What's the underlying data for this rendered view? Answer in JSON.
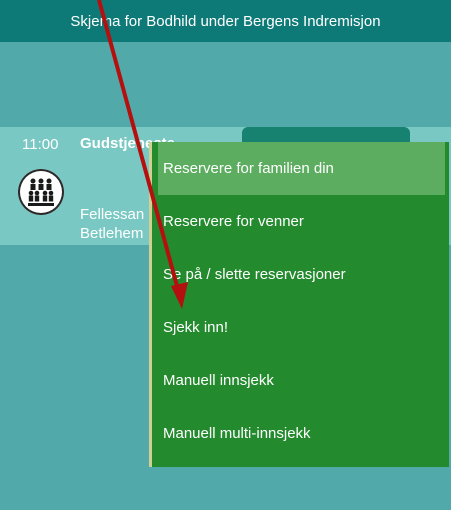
{
  "header": {
    "title": "Skjema for Bodhild under Bergens Indremisjon"
  },
  "event": {
    "time": "11:00",
    "title": "Gudstjeneste",
    "description_line1": "Fellessan",
    "description_line2": "Betlehem"
  },
  "menu": {
    "items": [
      {
        "label": "Reservere for familien din"
      },
      {
        "label": "Reservere for venner"
      },
      {
        "label": "Se på / slette reservasjoner"
      },
      {
        "label": "Sjekk inn!"
      },
      {
        "label": "Manuell innsjekk"
      },
      {
        "label": "Manuell multi-innsjekk"
      }
    ]
  },
  "annotation": {
    "arrow_color": "#b51010"
  },
  "colors": {
    "topbar": "#0e7a78",
    "background": "#52a9a9",
    "card": "#79c8c3",
    "menu": "#238a2e",
    "menu_highlight": "#5cad5f"
  }
}
